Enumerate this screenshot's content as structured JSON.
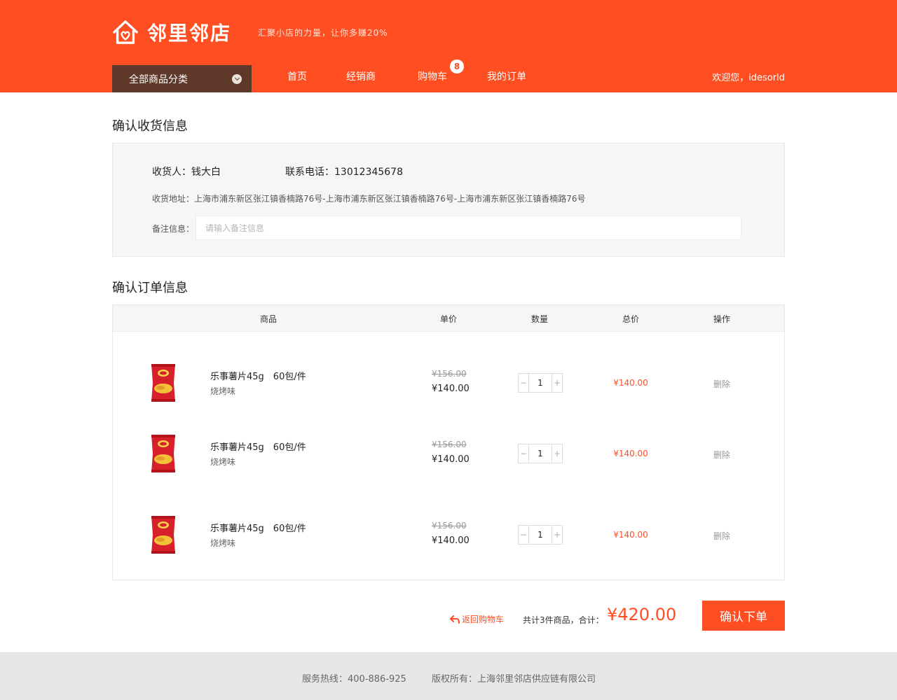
{
  "brand": {
    "name": "邻里邻店",
    "slogan": "汇聚小店的力量，让你多赚20%",
    "primary_color": "#ff4f22",
    "dark_color": "#5e3828"
  },
  "nav": {
    "category_label": "全部商品分类",
    "items": [
      "首页",
      "经销商",
      "购物车",
      "我的订单"
    ],
    "cart_count": "8",
    "welcome": "欢迎您，idesorld"
  },
  "shipping": {
    "section_title": "确认收货信息",
    "receiver": "收货人：钱大白",
    "phone": "联系电话：13012345678",
    "address": "收货地址：上海市浦东新区张江镇香楠路76号-上海市浦东新区张江镇香楠路76号-上海市浦东新区张江镇香楠路76号",
    "remark_label": "备注信息：",
    "remark_placeholder": "请输入备注信息",
    "remark_value": ""
  },
  "order": {
    "section_title": "确认订单信息",
    "columns": [
      "商品",
      "单价",
      "数量",
      "总价",
      "操作"
    ],
    "rows": [
      {
        "name": "乐事薯片45g　60包/件",
        "flavor": "烧烤味",
        "old_price": "¥156.00",
        "price": "¥140.00",
        "qty": "1",
        "total": "¥140.00",
        "action": "删除"
      },
      {
        "name": "乐事薯片45g　60包/件",
        "flavor": "烧烤味",
        "old_price": "¥156.00",
        "price": "¥140.00",
        "qty": "1",
        "total": "¥140.00",
        "action": "删除"
      },
      {
        "name": "乐事薯片45g　60包/件",
        "flavor": "烧烤味",
        "old_price": "¥156.00",
        "price": "¥140.00",
        "qty": "1",
        "total": "¥140.00",
        "action": "删除"
      }
    ]
  },
  "summary": {
    "back_label": "返回购物车",
    "count_text": "共计3件商品，合计：",
    "amount": "¥420.00",
    "confirm_label": "确认下单"
  },
  "footer": {
    "hotline": "服务热线：400-886-925",
    "copyright": "版权所有：上海邻里邻店供应链有限公司"
  },
  "icons": {
    "logo": "house-heart-icon",
    "category_toggle": "chevron-down-icon",
    "back": "return-arrow-icon",
    "product": "chips-bag-image"
  }
}
